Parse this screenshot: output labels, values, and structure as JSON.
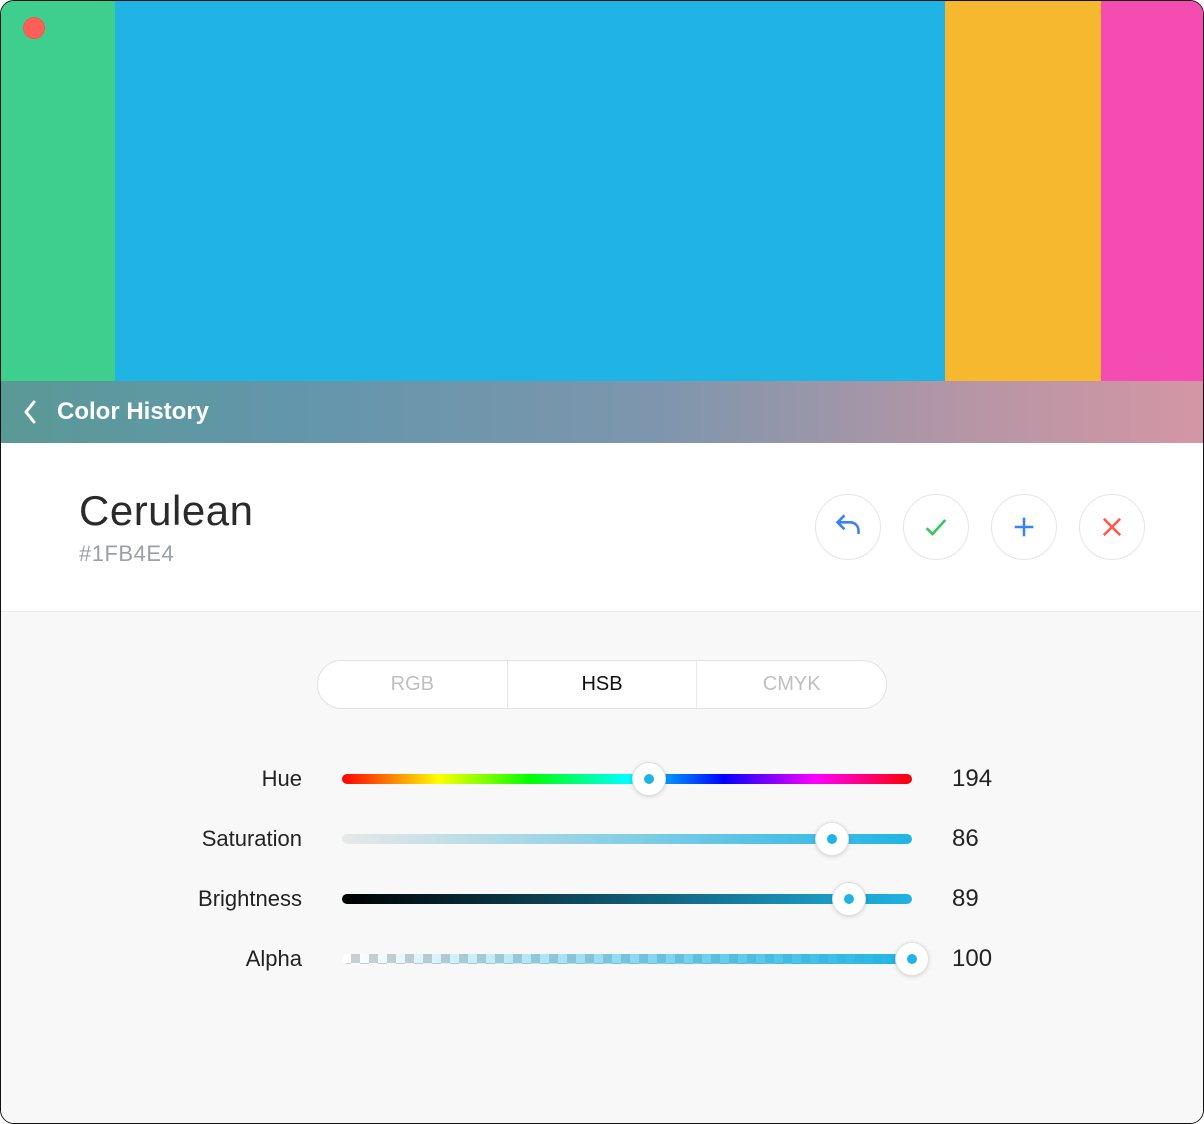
{
  "palette": [
    {
      "color": "#3ECF8E",
      "width": 9.5
    },
    {
      "color": "#1FB4E4",
      "width": 69.0
    },
    {
      "color": "#F5B82E",
      "width": 13.0
    },
    {
      "color": "#F44CB1",
      "width": 8.5
    }
  ],
  "history": {
    "title": "Color History"
  },
  "current": {
    "name": "Cerulean",
    "hex": "#1FB4E4"
  },
  "actions": {
    "undo_icon": "undo",
    "accept_icon": "check",
    "add_icon": "plus",
    "delete_icon": "close"
  },
  "color_modes": {
    "items": [
      "RGB",
      "HSB",
      "CMYK"
    ],
    "active_index": 1
  },
  "sliders": {
    "hue": {
      "label": "Hue",
      "value": 194,
      "max": 360
    },
    "saturation": {
      "label": "Saturation",
      "value": 86,
      "max": 100
    },
    "brightness": {
      "label": "Brightness",
      "value": 89,
      "max": 100
    },
    "alpha": {
      "label": "Alpha",
      "value": 100,
      "max": 100
    }
  }
}
